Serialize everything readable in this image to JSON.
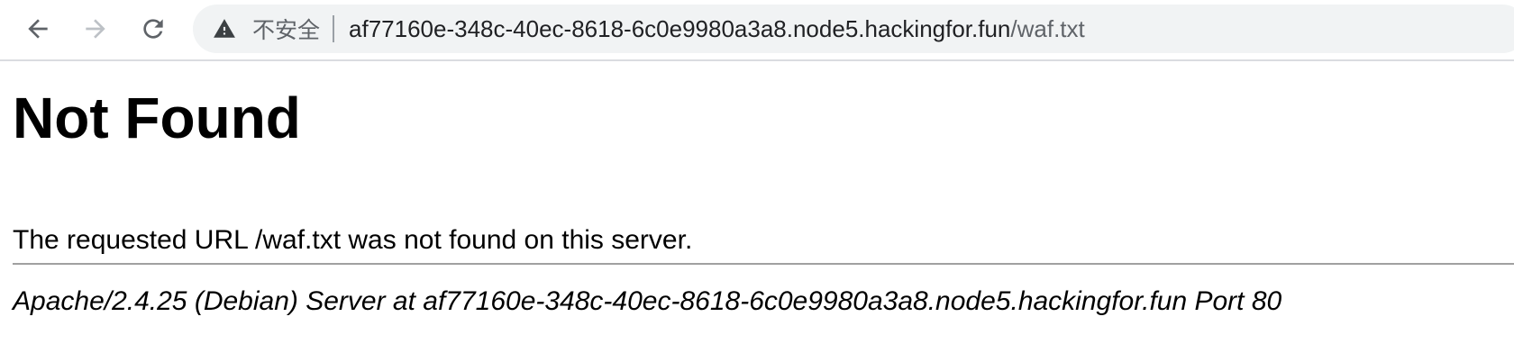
{
  "browser": {
    "security_label": "不安全",
    "url_host": "af77160e-348c-40ec-8618-6c0e9980a3a8.node5.hackingfor.fun",
    "url_path": "/waf.txt",
    "icons": {
      "back": "back-arrow-icon",
      "forward": "forward-arrow-icon",
      "reload": "reload-icon",
      "security": "warning-triangle-icon"
    }
  },
  "page": {
    "heading": "Not Found",
    "message": "The requested URL /waf.txt was not found on this server.",
    "server_signature": "Apache/2.4.25 (Debian) Server at af77160e-348c-40ec-8618-6c0e9980a3a8.node5.hackingfor.fun Port 80"
  }
}
